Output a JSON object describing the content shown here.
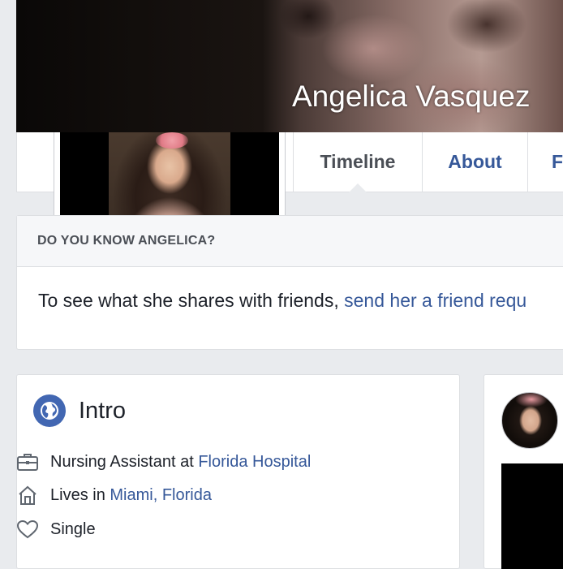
{
  "profile": {
    "name": "Angelica Vasquez"
  },
  "tabs": [
    {
      "label": "Timeline",
      "active": true
    },
    {
      "label": "About",
      "active": false
    },
    {
      "label": "F",
      "active": false
    }
  ],
  "know_card": {
    "header": "DO YOU KNOW ANGELICA?",
    "body_text": "To see what she shares with friends, ",
    "link_text": "send her a friend requ"
  },
  "intro": {
    "title": "Intro",
    "work": {
      "prefix": "Nursing Assistant at ",
      "link": "Florida Hospital",
      "icon": "briefcase-icon"
    },
    "lives": {
      "prefix": "Lives in ",
      "link": "Miami, Florida",
      "icon": "home-icon"
    },
    "relationship": {
      "text": "Single",
      "icon": "heart-icon"
    }
  },
  "colors": {
    "background": "#e9ebee",
    "link": "#365899",
    "accent": "#4267b2",
    "text": "#1d2129"
  }
}
